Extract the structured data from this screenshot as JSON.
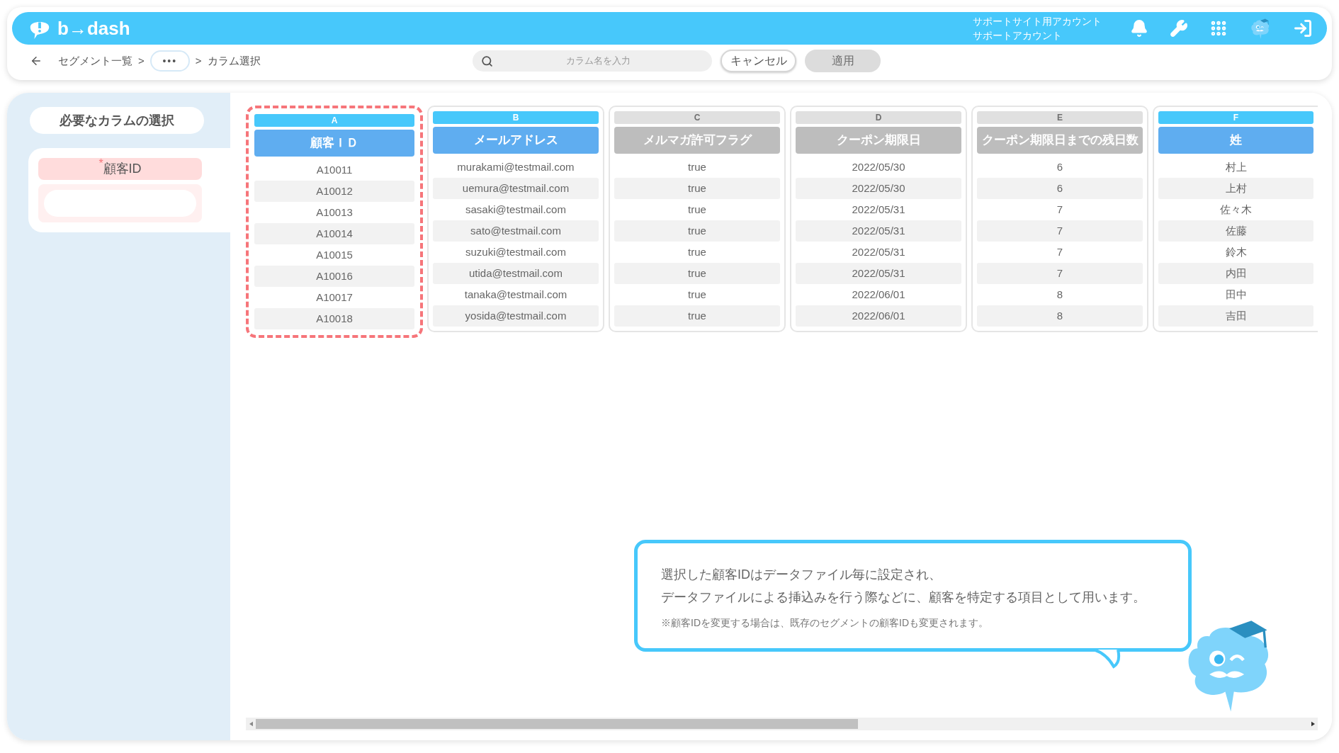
{
  "header": {
    "logo": "b→dash",
    "account_lines": [
      "サポートサイト用アカウント",
      "サポートアカウント"
    ]
  },
  "toolbar": {
    "breadcrumb": [
      {
        "kind": "link",
        "text": "セグメント一覧"
      },
      {
        "kind": "sep",
        "text": ">"
      },
      {
        "kind": "more",
        "text": "•••"
      },
      {
        "kind": "sep",
        "text": ">"
      },
      {
        "kind": "current",
        "text": "カラム選択"
      }
    ],
    "search": {
      "placeholder": "カラム名を入力"
    },
    "buttons": [
      {
        "label": "キャンセル",
        "disabled": false
      },
      {
        "label": "適用",
        "disabled": true
      }
    ]
  },
  "sidebar": {
    "title": "必要なカラムの選択",
    "required_mark": "*",
    "field_label": "顧客ID"
  },
  "columns": [
    {
      "letter": "A",
      "header": "顧客ＩＤ",
      "selected": true,
      "highlighted": true,
      "cells": [
        "A10011",
        "A10012",
        "A10013",
        "A10014",
        "A10015",
        "A10016",
        "A10017",
        "A10018"
      ]
    },
    {
      "letter": "B",
      "header": "メールアドレス",
      "selected": true,
      "highlighted": false,
      "cells": [
        "murakami@testmail.com",
        "uemura@testmail.com",
        "sasaki@testmail.com",
        "sato@testmail.com",
        "suzuki@testmail.com",
        "utida@testmail.com",
        "tanaka@testmail.com",
        "yosida@testmail.com"
      ]
    },
    {
      "letter": "C",
      "header": "メルマガ許可フラグ",
      "selected": false,
      "highlighted": false,
      "cells": [
        "true",
        "true",
        "true",
        "true",
        "true",
        "true",
        "true",
        "true"
      ]
    },
    {
      "letter": "D",
      "header": "クーポン期限日",
      "selected": false,
      "highlighted": false,
      "cells": [
        "2022/05/30",
        "2022/05/30",
        "2022/05/31",
        "2022/05/31",
        "2022/05/31",
        "2022/05/31",
        "2022/06/01",
        "2022/06/01"
      ]
    },
    {
      "letter": "E",
      "header": "クーポン期限日までの残日数",
      "selected": false,
      "highlighted": false,
      "cells": [
        "6",
        "6",
        "7",
        "7",
        "7",
        "7",
        "8",
        "8"
      ]
    },
    {
      "letter": "F",
      "header": "姓",
      "selected": true,
      "highlighted": false,
      "cells": [
        "村上",
        "上村",
        "佐々木",
        "佐藤",
        "鈴木",
        "内田",
        "田中",
        "吉田"
      ]
    }
  ],
  "hint": {
    "lines": [
      "選択した顧客IDはデータファイル毎に設定され、",
      "データファイルによる挿込みを行う際などに、顧客を特定する項目として用います。"
    ],
    "note": "※顧客IDを変更する場合は、既存のセグメントの顧客IDも変更されます。"
  }
}
